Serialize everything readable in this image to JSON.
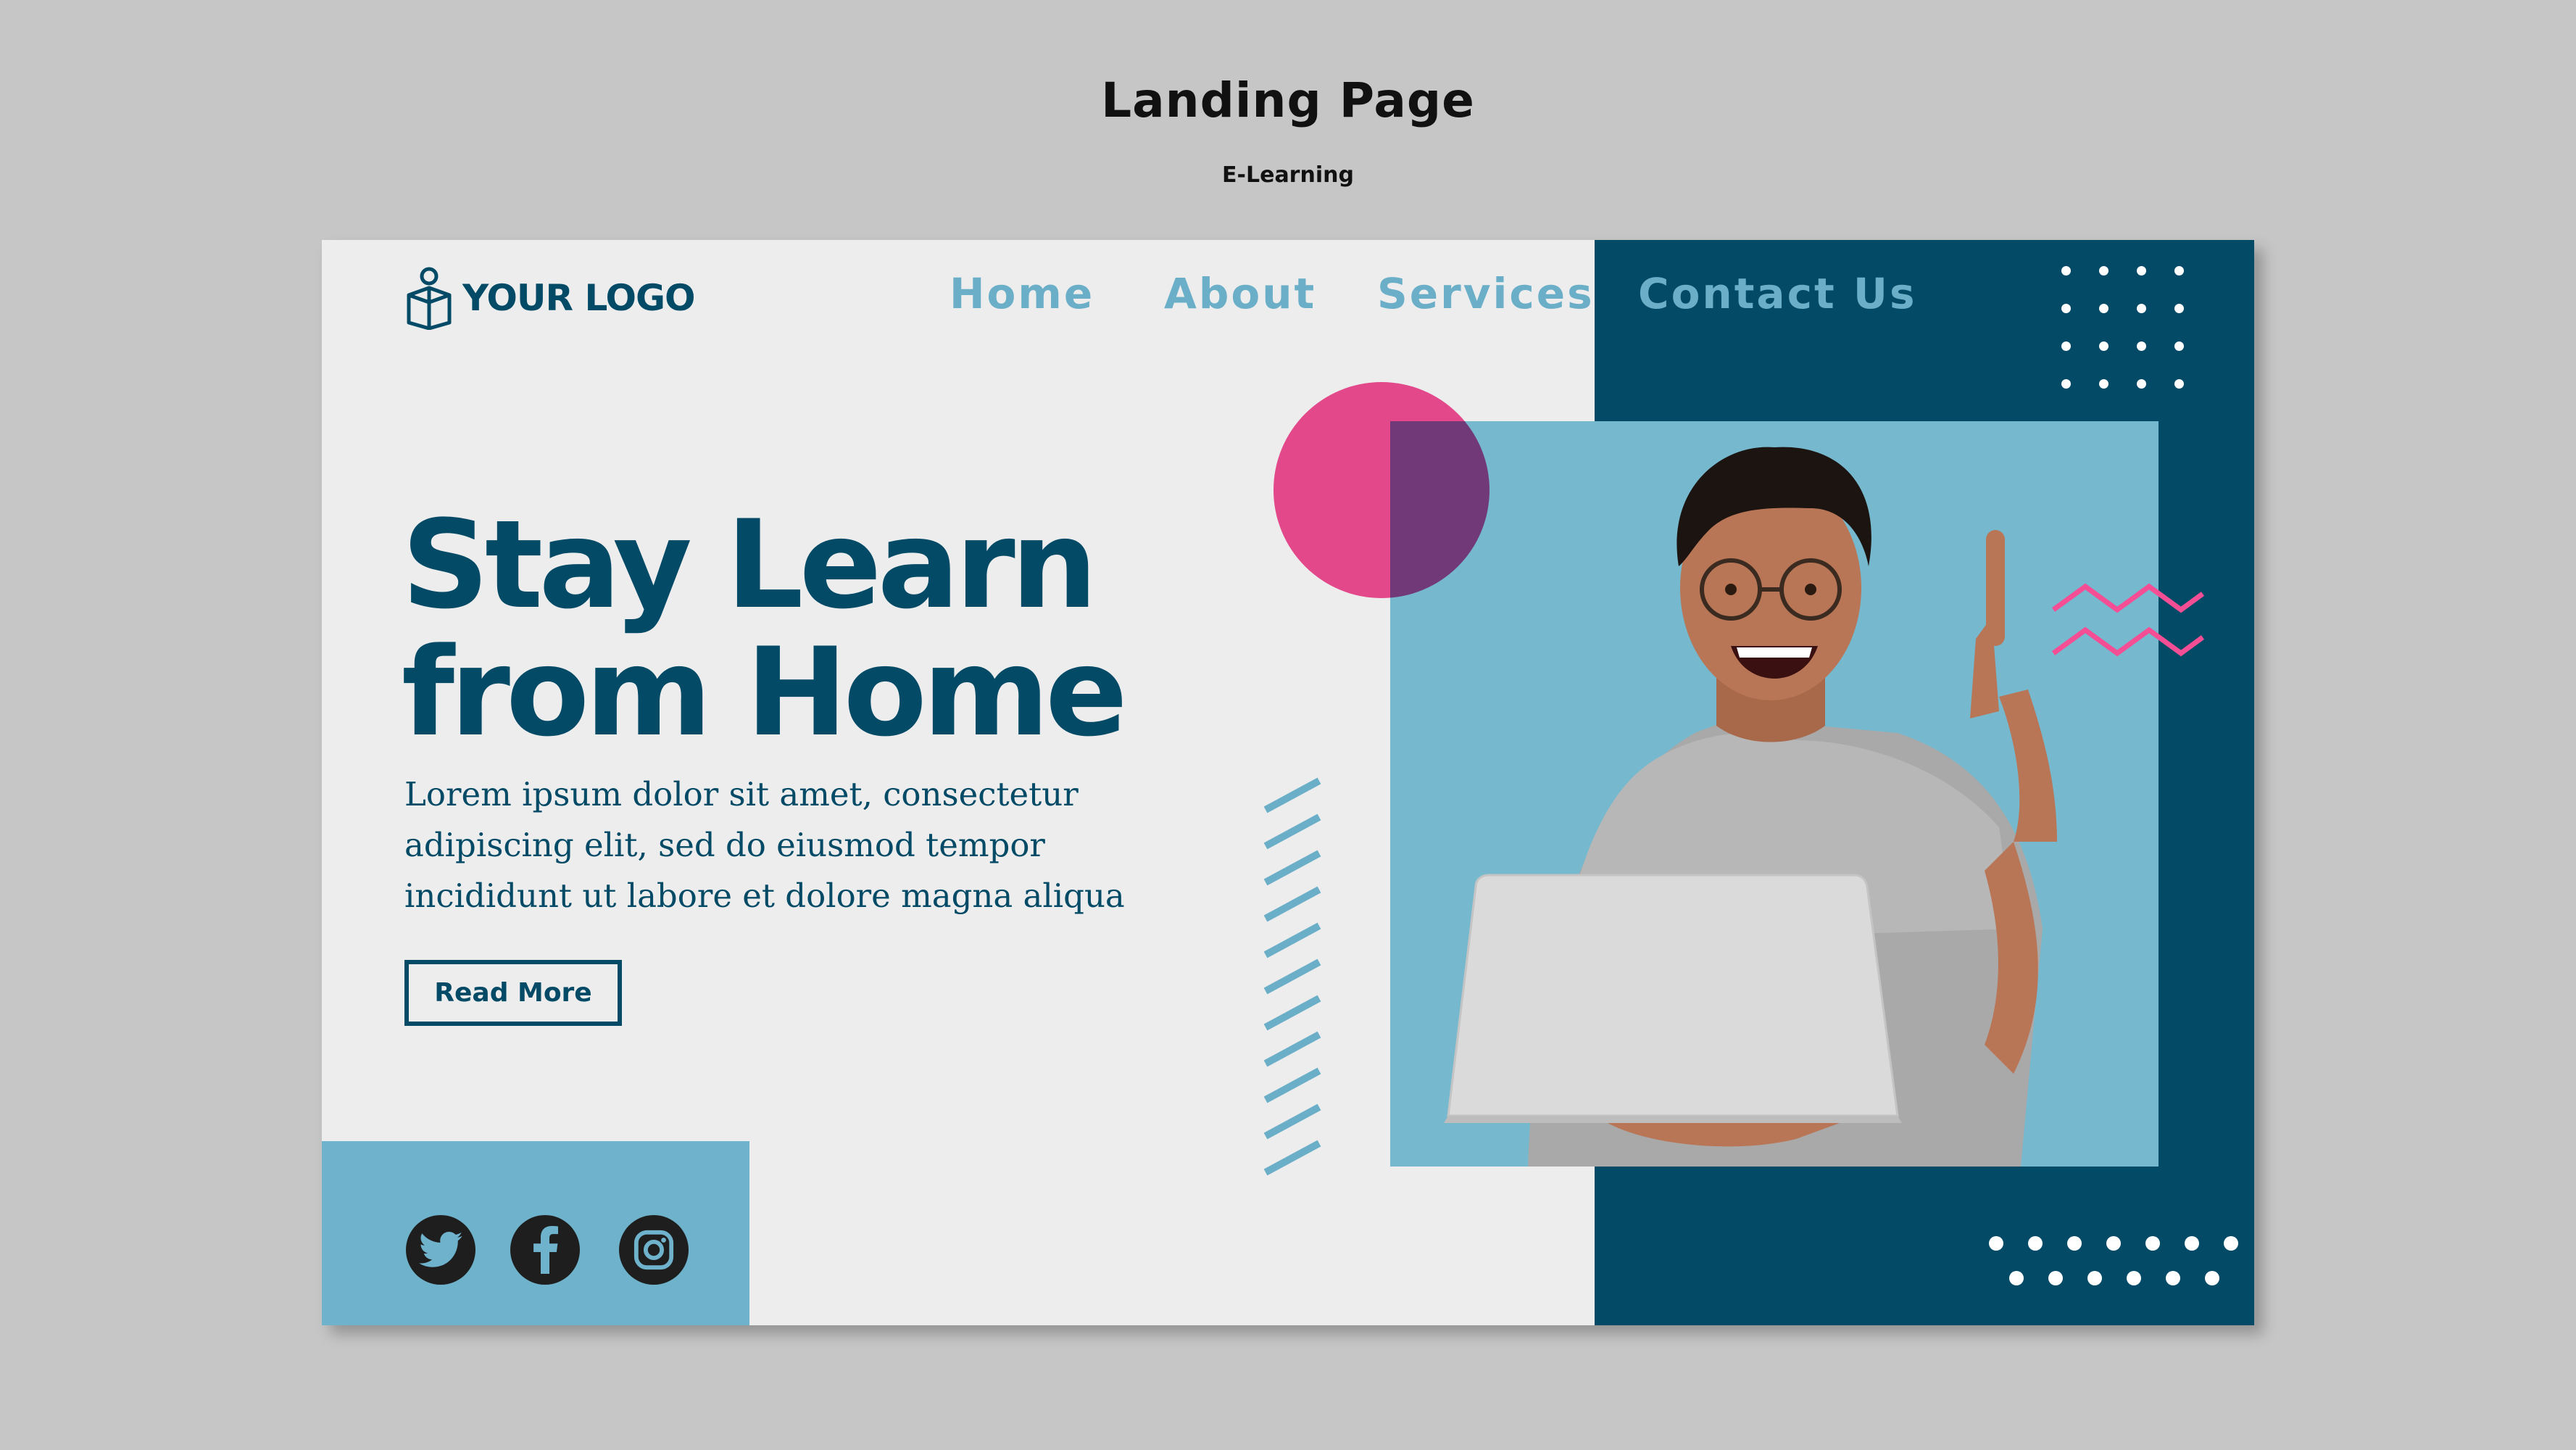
{
  "header": {
    "title": "Landing Page",
    "subtitle": "E-Learning"
  },
  "logo": {
    "text": "YOUR LOGO",
    "icon": "book-reader-icon"
  },
  "nav": {
    "items": [
      {
        "label": "Home"
      },
      {
        "label": "About"
      },
      {
        "label": "Services"
      },
      {
        "label": "Contact Us"
      }
    ]
  },
  "hero": {
    "title_line1": "Stay Learn",
    "title_line2": "from Home",
    "body_line1": "Lorem ipsum dolor sit amet, consectetur",
    "body_line2": "adipiscing elit, sed do eiusmod tempor",
    "body_line3": "incididunt ut labore et dolore magna aliqua",
    "cta_label": "Read More"
  },
  "social": {
    "icons": [
      "twitter-icon",
      "facebook-icon",
      "instagram-icon"
    ]
  },
  "colors": {
    "background": "#c6c6c6",
    "card": "#ededed",
    "primary": "#024a66",
    "accent_light": "#6fb2cb",
    "accent_pink": "#f54e95",
    "photo_bg": "#76b8ce"
  }
}
